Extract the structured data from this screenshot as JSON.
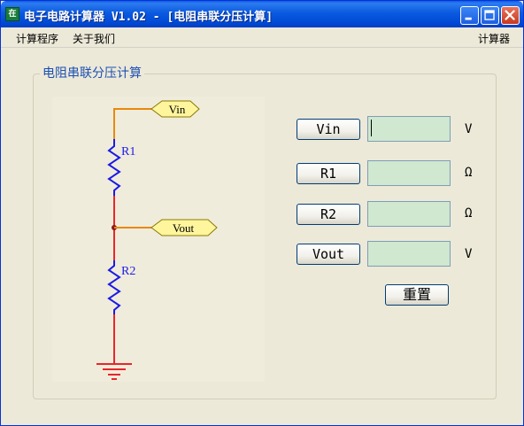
{
  "window": {
    "icon_text": "在",
    "title": "电子电路计算器 V1.02 - [电阻串联分压计算]"
  },
  "menu": {
    "left": [
      "计算程序",
      "关于我们"
    ],
    "right": "计算器"
  },
  "panel": {
    "title": "电阻串联分压计算"
  },
  "schematic": {
    "labels": {
      "vin_tag": "Vin",
      "vout_tag": "Vout",
      "r1": "R1",
      "r2": "R2"
    },
    "colors": {
      "wire_top": "#e8890c",
      "wire_main": "#e8262b",
      "resistor": "#1a1ae6",
      "tag_fill": "#fff59d",
      "ground": "#e8262b"
    }
  },
  "form": {
    "rows": [
      {
        "label": "Vin",
        "value": "",
        "unit": "V"
      },
      {
        "label": "R1",
        "value": "",
        "unit": "Ω"
      },
      {
        "label": "R2",
        "value": "",
        "unit": "Ω"
      },
      {
        "label": "Vout",
        "value": "",
        "unit": "V"
      }
    ],
    "reset_label": "重置"
  },
  "theme": {
    "field_bg": "#cfe8cf",
    "window_bg": "#ece9d8",
    "title_blue": "#0b5ae0"
  }
}
